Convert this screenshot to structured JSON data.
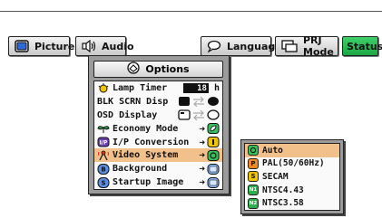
{
  "tabs": {
    "picture": "Picture",
    "audio": "Audio",
    "language": "Language",
    "prj_mode": "PRJ Mode",
    "status": "Status"
  },
  "options_menu": {
    "title": "Options",
    "items": [
      {
        "label": "Lamp Timer",
        "value": "18",
        "unit": "h"
      },
      {
        "label": "BLK SCRN Disp"
      },
      {
        "label": "OSD Display"
      },
      {
        "label": "Economy Mode"
      },
      {
        "label": "I/P Conversion"
      },
      {
        "label": "Video System"
      },
      {
        "label": "Background"
      },
      {
        "label": "Startup Image"
      }
    ],
    "selected_item": "Video System"
  },
  "video_system_menu": {
    "options": [
      {
        "badge": "",
        "label": "Auto"
      },
      {
        "badge": "P",
        "label": "PAL(50/60Hz)"
      },
      {
        "badge": "S",
        "label": "SECAM"
      },
      {
        "badge": "N1",
        "label": "NTSC4.43"
      },
      {
        "badge": "N2",
        "label": "NTSC3.58"
      }
    ],
    "selected_option": "Auto"
  },
  "colors": {
    "selection": "#f2c08a",
    "status_tab": "#22b04d",
    "menu_frame": "#9b9b9b"
  }
}
